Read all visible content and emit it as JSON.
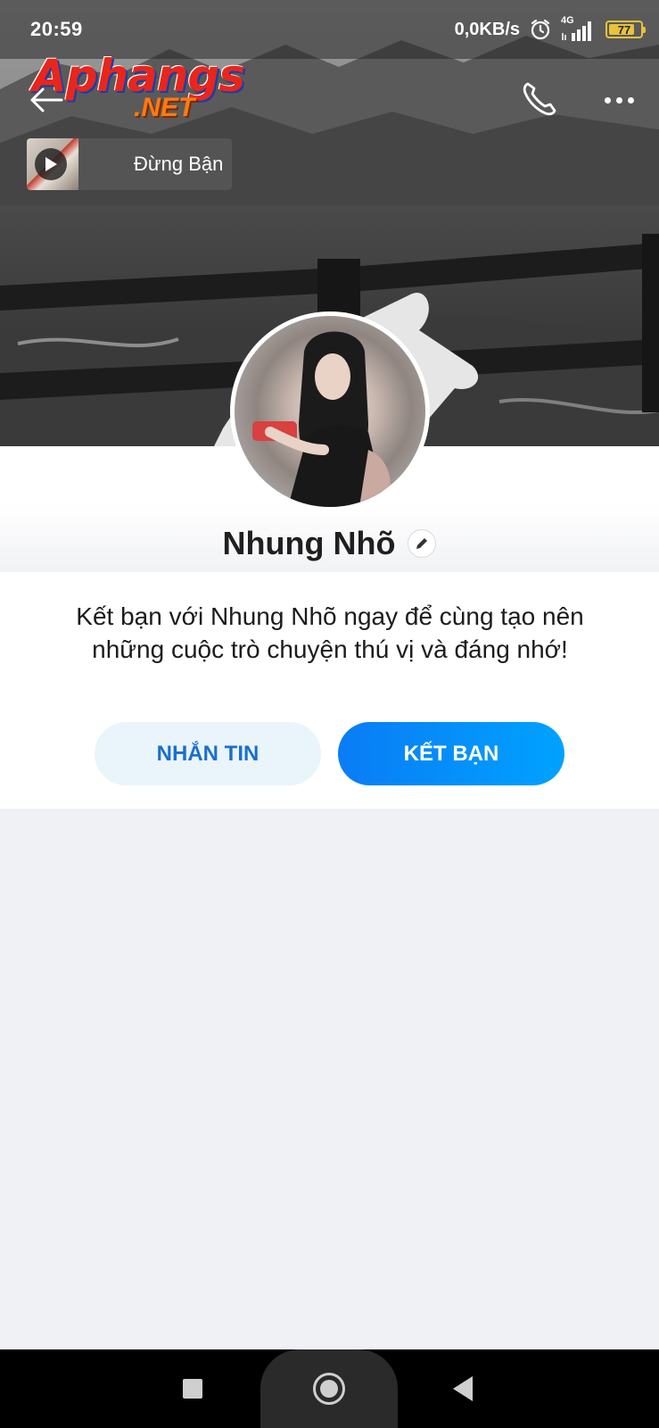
{
  "status_bar": {
    "time": "20:59",
    "net_speed": "0,0KB/s",
    "network_type": "4G",
    "battery_level": "77",
    "icons": [
      "alarm-icon",
      "signal-icon",
      "battery-icon"
    ]
  },
  "watermark": {
    "brand_main": "Aphangs",
    "brand_suffix": ".NET"
  },
  "header": {
    "back_icon": "back-arrow-icon",
    "call_icon": "phone-icon",
    "more_icon": "more-dots-icon"
  },
  "music": {
    "song_title": "Đừng Bận",
    "play_icon": "play-icon"
  },
  "profile": {
    "name": "Nhung Nhõ",
    "edit_icon": "pencil-icon",
    "intro_text": "Kết bạn với Nhung Nhõ ngay để cùng tạo nên những cuộc trò chuyện thú vị và đáng nhớ!"
  },
  "actions": {
    "message_label": "NHẮN TIN",
    "add_friend_label": "KẾT BẠN"
  },
  "colors": {
    "accent": "#0a7cf5",
    "message_btn_bg": "#eaf4fb",
    "message_btn_text": "#1a6fd0",
    "page_bg": "#eff1f5",
    "battery": "#e9c23a"
  },
  "nav_bar": {
    "icons": [
      "recents-square-icon",
      "home-circle-icon",
      "back-triangle-icon"
    ]
  }
}
